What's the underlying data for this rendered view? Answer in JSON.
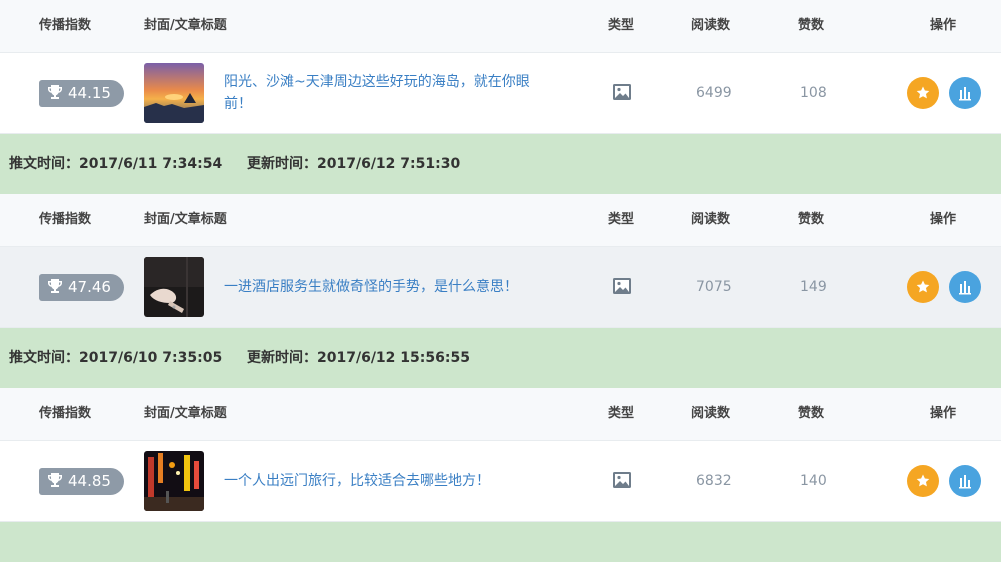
{
  "headers": {
    "score": "传播指数",
    "cover_title": "封面/文章标题",
    "type": "类型",
    "reads": "阅读数",
    "likes": "赞数",
    "actions": "操作"
  },
  "articles": [
    {
      "score": "44.15",
      "title_line1": "阳光、沙滩~天津周边这些好玩的海岛，就在你眼",
      "title_line2": "前！",
      "type_icon": "image-icon",
      "reads": "6499",
      "likes": "108",
      "pub_label": "推文时间：",
      "pub_time": "2017/6/11 7:34:54",
      "upd_label": "更新时间：",
      "upd_time": "2017/6/12 7:51:30"
    },
    {
      "score": "47.46",
      "title_line1": "一进酒店服务生就做奇怪的手势，是什么意思！",
      "title_line2": "",
      "type_icon": "image-icon",
      "reads": "7075",
      "likes": "149",
      "pub_label": "推文时间：",
      "pub_time": "2017/6/10 7:35:05",
      "upd_label": "更新时间：",
      "upd_time": "2017/6/12 15:56:55"
    },
    {
      "score": "44.85",
      "title_line1": "一个人出远门旅行，比较适合去哪些地方！",
      "title_line2": "",
      "type_icon": "image-icon",
      "reads": "6832",
      "likes": "140"
    }
  ],
  "colors": {
    "badge": "#8e9aa7",
    "title_link": "#3a7fc4",
    "meta_band": "#cde6cc",
    "star_button": "#f5a623",
    "chart_button": "#4aa3df"
  }
}
